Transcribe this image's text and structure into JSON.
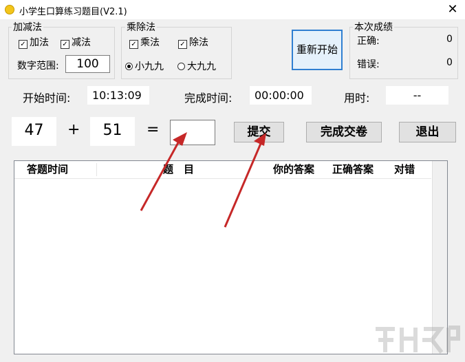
{
  "window": {
    "title": "小学生口算练习题目(V2.1)",
    "close_glyph": "✕"
  },
  "add_sub": {
    "label": "加减法",
    "add": {
      "label": "加法",
      "checked": true
    },
    "sub": {
      "label": "减法",
      "checked": true
    },
    "range_label": "数字范围:",
    "range_value": "100"
  },
  "mul_div": {
    "label": "乘除法",
    "mul": {
      "label": "乘法",
      "checked": false
    },
    "div": {
      "label": "除法",
      "checked": false
    },
    "small": {
      "label": "小九九",
      "selected": true
    },
    "big": {
      "label": "大九九",
      "selected": false
    }
  },
  "restart_label": "重新开始",
  "score": {
    "label": "本次成绩",
    "correct_label": "正确:",
    "correct_value": "0",
    "wrong_label": "错误:",
    "wrong_value": "0"
  },
  "time": {
    "start_label": "开始时间:",
    "start_value": "10:13:09",
    "finish_label": "完成时间:",
    "finish_value": "00:00:00",
    "used_label": "用时:",
    "used_value": "--"
  },
  "question": {
    "a": "47",
    "op": "+",
    "b": "51",
    "eq": "=",
    "answer": ""
  },
  "buttons": {
    "submit": "提交",
    "finish": "完成交卷",
    "exit": "退出"
  },
  "list": {
    "columns": [
      "答题时间",
      "题　目",
      "你的答案",
      "正确答案",
      "对错"
    ]
  },
  "colors": {
    "arrow": "#d32f2f"
  }
}
